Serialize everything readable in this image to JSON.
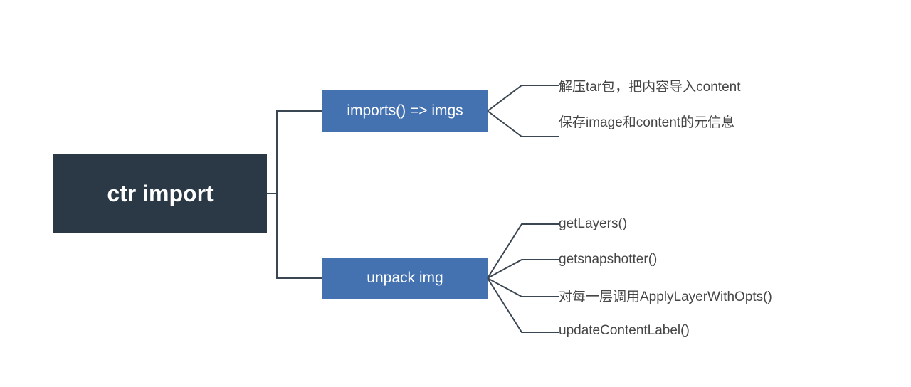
{
  "root": {
    "label": "ctr import"
  },
  "branches": [
    {
      "label": "imports()  => imgs",
      "leaves": [
        "解压tar包，把内容导入content",
        "保存image和content的元信息"
      ]
    },
    {
      "label": "unpack img",
      "leaves": [
        "getLayers()",
        "getsnapshotter()",
        "对每一层调用ApplyLayerWithOpts()",
        "updateContentLabel()"
      ]
    }
  ],
  "chart_data": {
    "type": "tree",
    "root": "ctr import",
    "children": [
      {
        "name": "imports() => imgs",
        "children": [
          {
            "name": "解压tar包，把内容导入content"
          },
          {
            "name": "保存image和content的元信息"
          }
        ]
      },
      {
        "name": "unpack img",
        "children": [
          {
            "name": "getLayers()"
          },
          {
            "name": "getsnapshotter()"
          },
          {
            "name": "对每一层调用ApplyLayerWithOpts()"
          },
          {
            "name": "updateContentLabel()"
          }
        ]
      }
    ]
  }
}
